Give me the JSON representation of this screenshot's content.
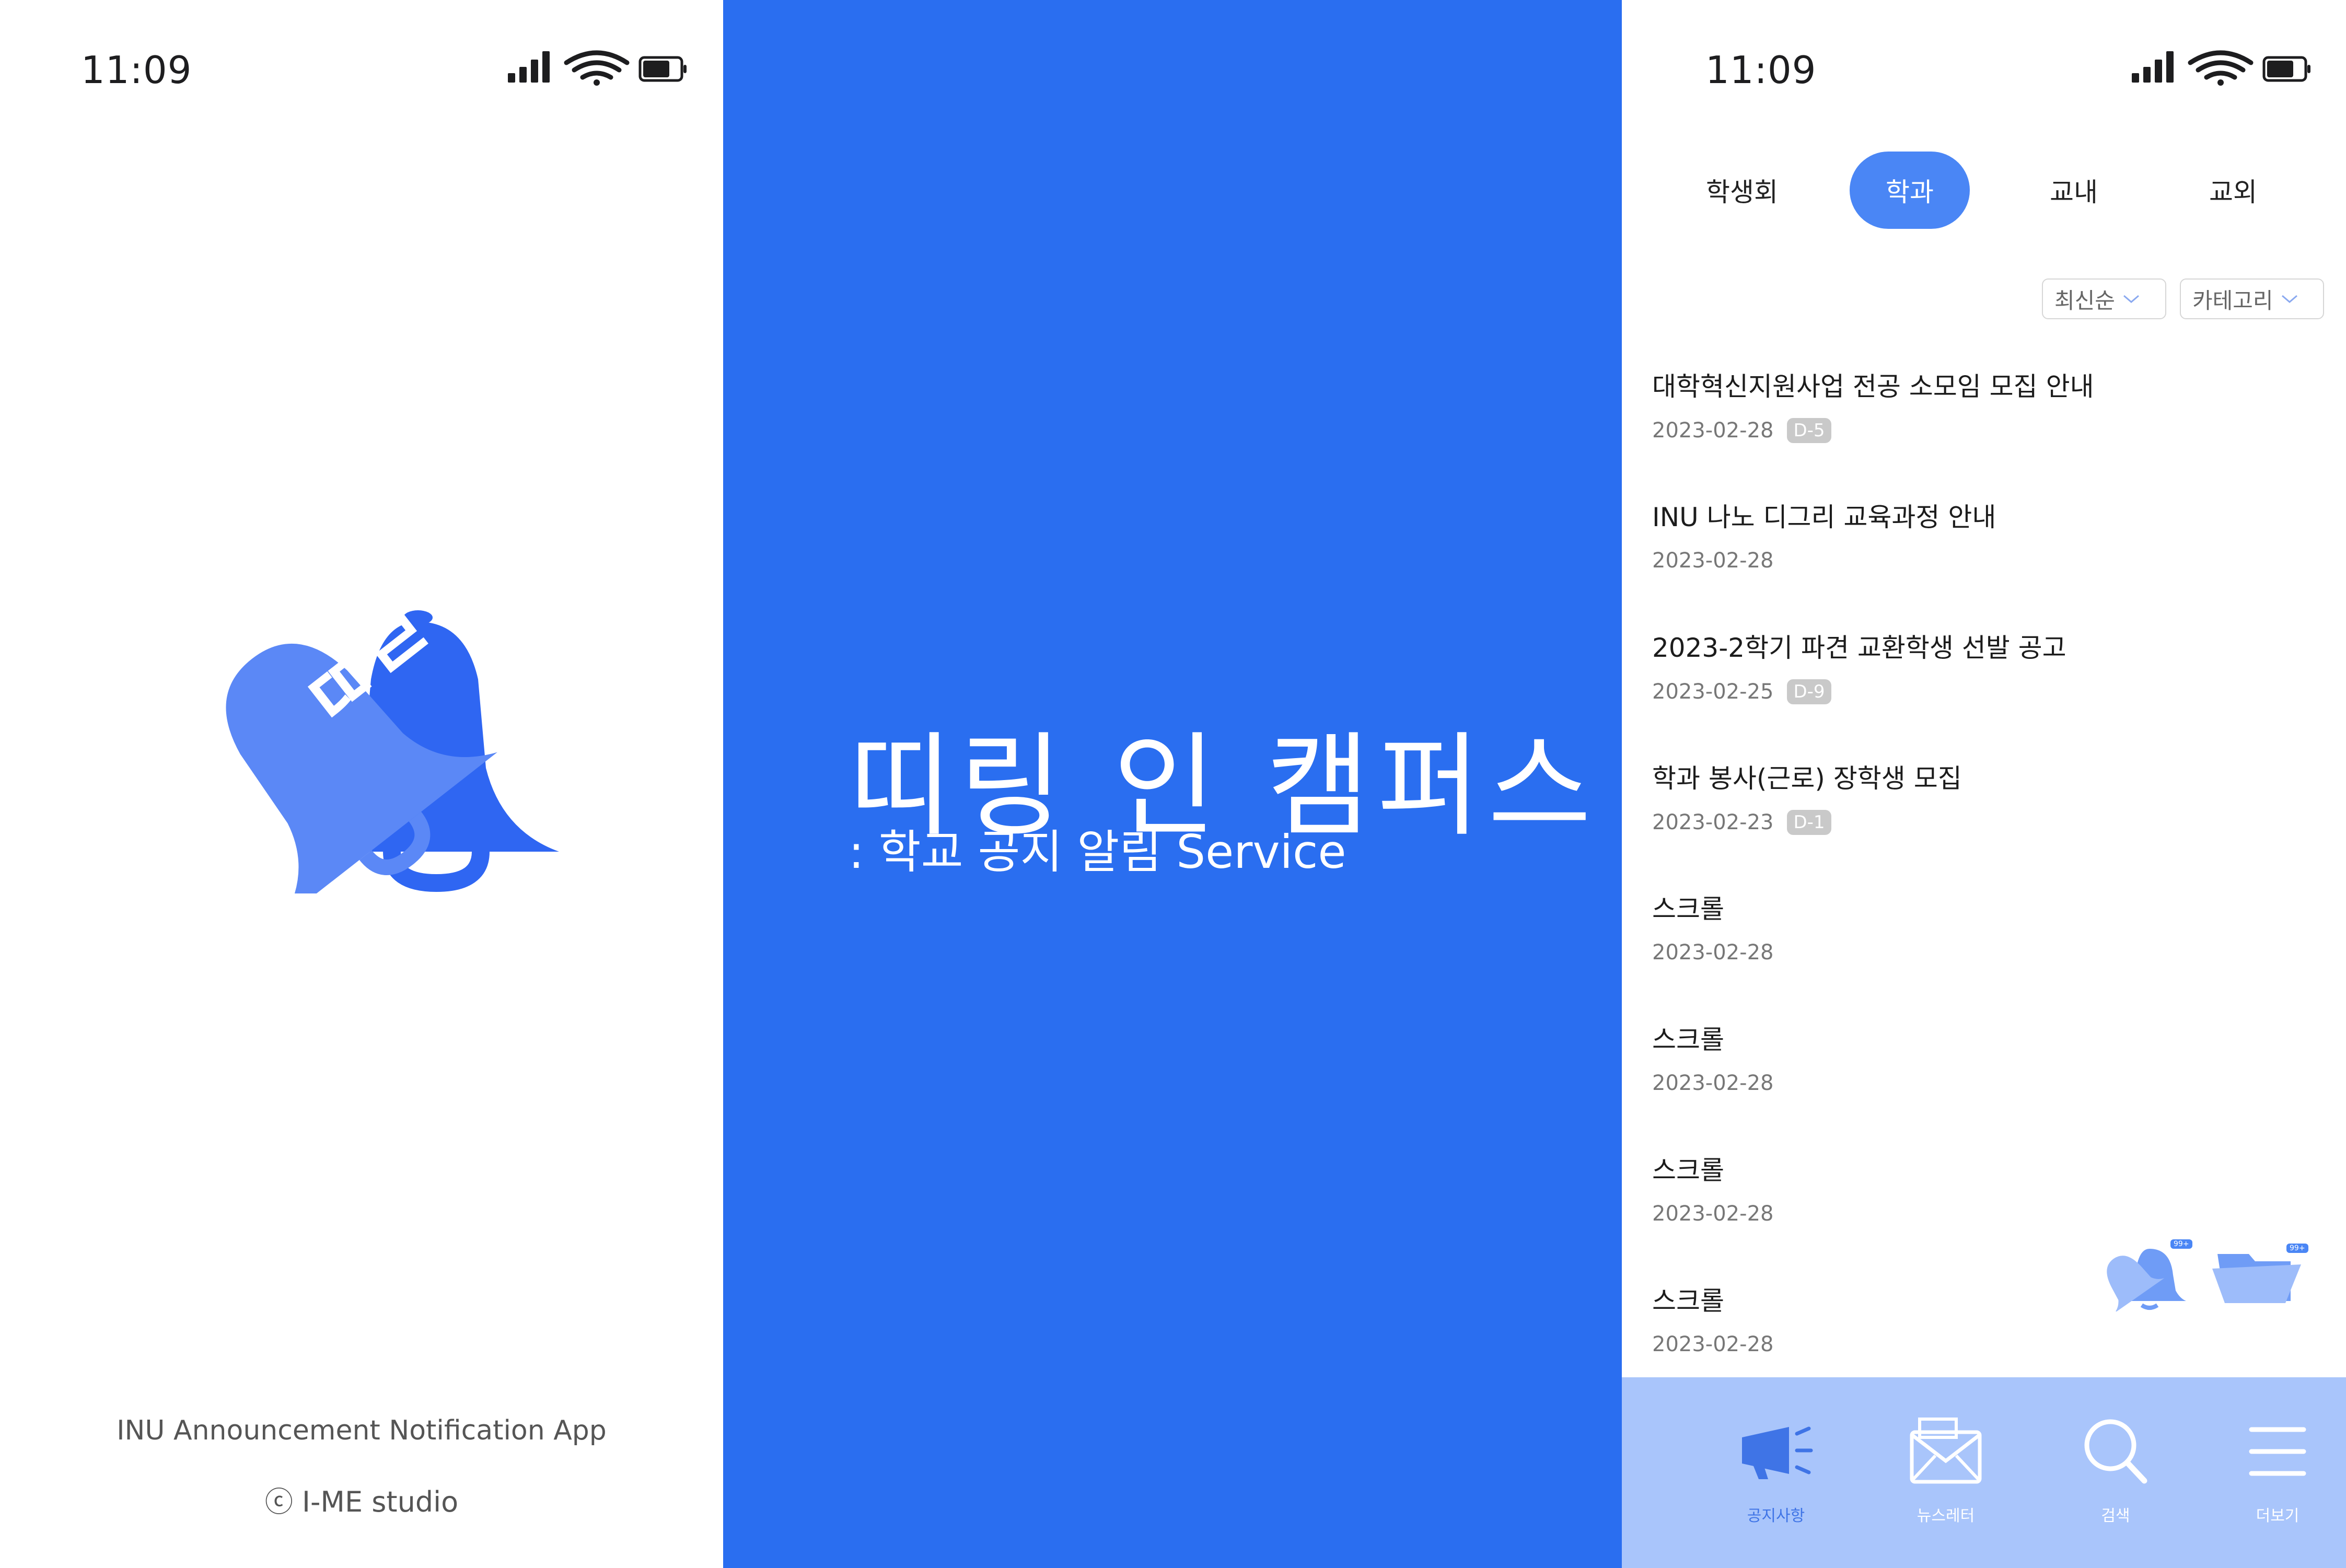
{
  "splash": {
    "status_time": "11:09",
    "logo_letters": "ㄸㄹ",
    "footer_line1": "INU Announcement Notification App",
    "copyright_symbol": "ⓒ",
    "footer_line2": "I-ME studio"
  },
  "title_screen": {
    "title": "띠링 인 캠퍼스",
    "subtitle": ": 학교 공지 알림 Service",
    "background_color": "#2a6ef0"
  },
  "main": {
    "status_time": "11:09",
    "tabs": [
      {
        "label": "학생회",
        "active": false
      },
      {
        "label": "학과",
        "active": true
      },
      {
        "label": "교내",
        "active": false
      },
      {
        "label": "교외",
        "active": false
      }
    ],
    "filters": {
      "sort_label": "최신순",
      "category_label": "카테고리"
    },
    "notices": [
      {
        "title": "대학혁신지원사업 전공 소모임 모집 안내",
        "date": "2023-02-28",
        "dday": "D-5"
      },
      {
        "title": "INU 나노 디그리 교육과정 안내",
        "date": "2023-02-28",
        "dday": ""
      },
      {
        "title": "2023-2학기 파견 교환학생 선발 공고",
        "date": "2023-02-25",
        "dday": "D-9"
      },
      {
        "title": "학과 봉사(근로) 장학생 모집",
        "date": "2023-02-23",
        "dday": "D-1"
      },
      {
        "title": "스크롤",
        "date": "2023-02-28",
        "dday": ""
      },
      {
        "title": "스크롤",
        "date": "2023-02-28",
        "dday": ""
      },
      {
        "title": "스크롤",
        "date": "2023-02-28",
        "dday": ""
      },
      {
        "title": "스크롤",
        "date": "2023-02-28",
        "dday": ""
      }
    ],
    "floating": {
      "bell_badge": "99+",
      "folder_badge": "99+"
    },
    "bottom_nav": [
      {
        "label": "공지사항",
        "icon": "megaphone-icon",
        "active": true
      },
      {
        "label": "뉴스레터",
        "icon": "mail-icon",
        "active": false
      },
      {
        "label": "검색",
        "icon": "search-icon",
        "active": false
      },
      {
        "label": "더보기",
        "icon": "menu-icon",
        "active": false
      }
    ],
    "accent_color": "#4a86f5",
    "nav_background": "#a9c5fb"
  }
}
